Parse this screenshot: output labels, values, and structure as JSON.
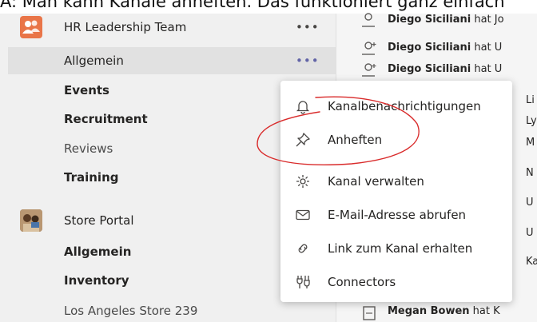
{
  "caption": "A: Man kann Kanäle anheften. Das funktioniert ganz einfach",
  "sidebar": {
    "teams": [
      {
        "name": "HR Leadership Team",
        "more": "•••",
        "channels": [
          "Allgemein",
          "Events",
          "Recruitment",
          "Reviews",
          "Training"
        ],
        "selected_more": "•••"
      },
      {
        "name": "Store Portal",
        "channels": [
          "Allgemein",
          "Inventory",
          "Los Angeles Store 239"
        ]
      }
    ]
  },
  "feed": {
    "items": [
      {
        "name": "Diego Siciliani",
        "text": " hat Jo"
      },
      {
        "name": "Diego Siciliani",
        "text": " hat U"
      },
      {
        "name": "Diego Siciliani",
        "text": " hat U"
      },
      {
        "name": "",
        "text": "Li"
      },
      {
        "name": "",
        "text": "Ly"
      },
      {
        "name": "",
        "text": "M"
      },
      {
        "name": "",
        "text": "N"
      },
      {
        "name": "",
        "text": "U"
      },
      {
        "name": "",
        "text": "U"
      },
      {
        "name": "",
        "text": "Ka"
      },
      {
        "name": "Megan Bowen",
        "text": " hat K"
      }
    ]
  },
  "context_menu": {
    "items": [
      {
        "label": "Kanalbenachrichtigungen",
        "icon": "bell-icon"
      },
      {
        "label": "Anheften",
        "icon": "pin-icon"
      },
      {
        "label": "Kanal verwalten",
        "icon": "gear-icon"
      },
      {
        "label": "E-Mail-Adresse abrufen",
        "icon": "mail-icon"
      },
      {
        "label": "Link zum Kanal erhalten",
        "icon": "link-icon"
      },
      {
        "label": "Connectors",
        "icon": "connectors-icon"
      }
    ]
  },
  "colors": {
    "accent": "#e97548",
    "annotation": "#d92b2b",
    "selected_row": "#e1e1e1",
    "more_active": "#6264a7"
  }
}
